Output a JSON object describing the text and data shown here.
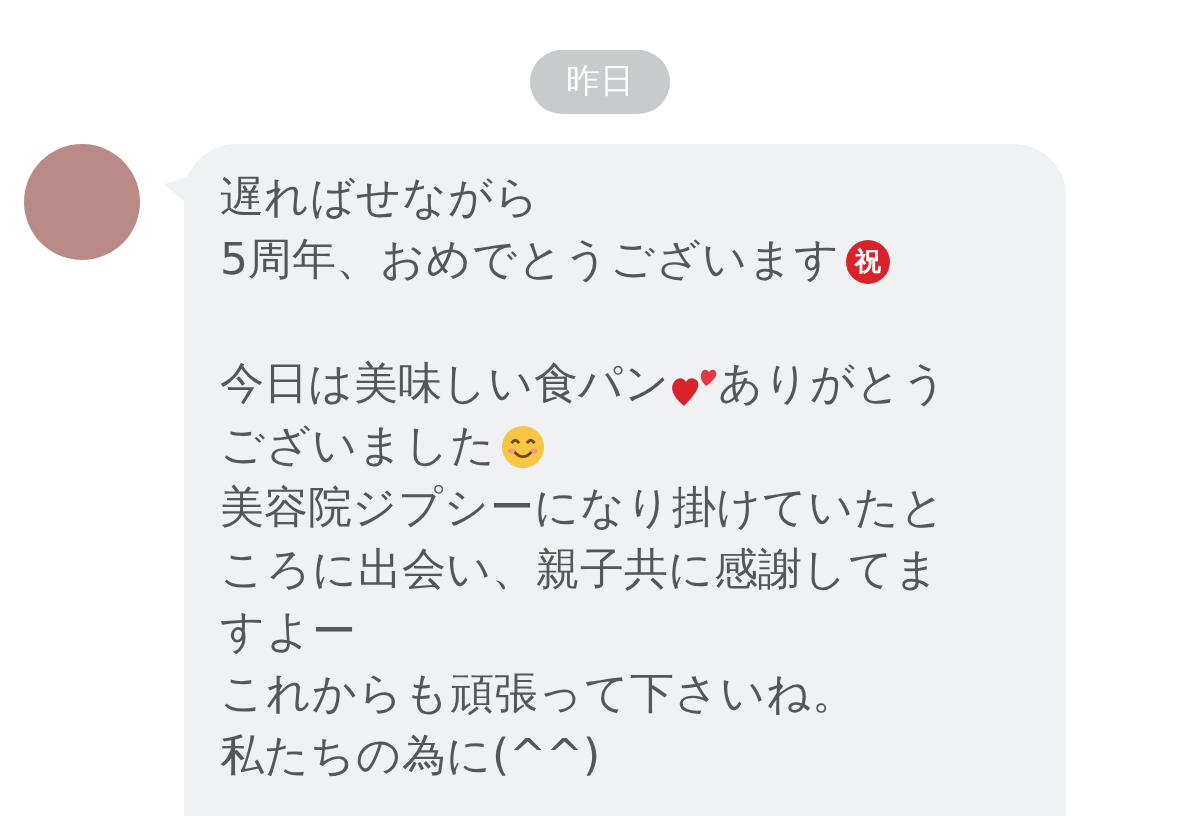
{
  "date_label": "昨日",
  "message": {
    "paragraphs": [
      {
        "lines": [
          [
            {
              "kind": "text",
              "text": "遅ればせながら"
            }
          ],
          [
            {
              "kind": "text",
              "text": "5周年、おめでとうございます"
            },
            {
              "kind": "badge",
              "text": "祝"
            }
          ]
        ]
      },
      {
        "lines": [
          [
            {
              "kind": "text",
              "text": "今日は美味しい食パン"
            },
            {
              "kind": "hearts"
            },
            {
              "kind": "text",
              "text": "ありがとう"
            }
          ],
          [
            {
              "kind": "text",
              "text": "ございました"
            },
            {
              "kind": "smile"
            }
          ],
          [
            {
              "kind": "text",
              "text": "美容院ジプシーになり掛けていたと"
            }
          ],
          [
            {
              "kind": "text",
              "text": "ころに出会い、親子共に感謝してま"
            }
          ],
          [
            {
              "kind": "text",
              "text": "すよー"
            }
          ],
          [
            {
              "kind": "text",
              "text": "これからも頑張って下さいね。"
            }
          ],
          [
            {
              "kind": "text",
              "text": "私たちの為に(^^)"
            }
          ]
        ]
      }
    ]
  }
}
